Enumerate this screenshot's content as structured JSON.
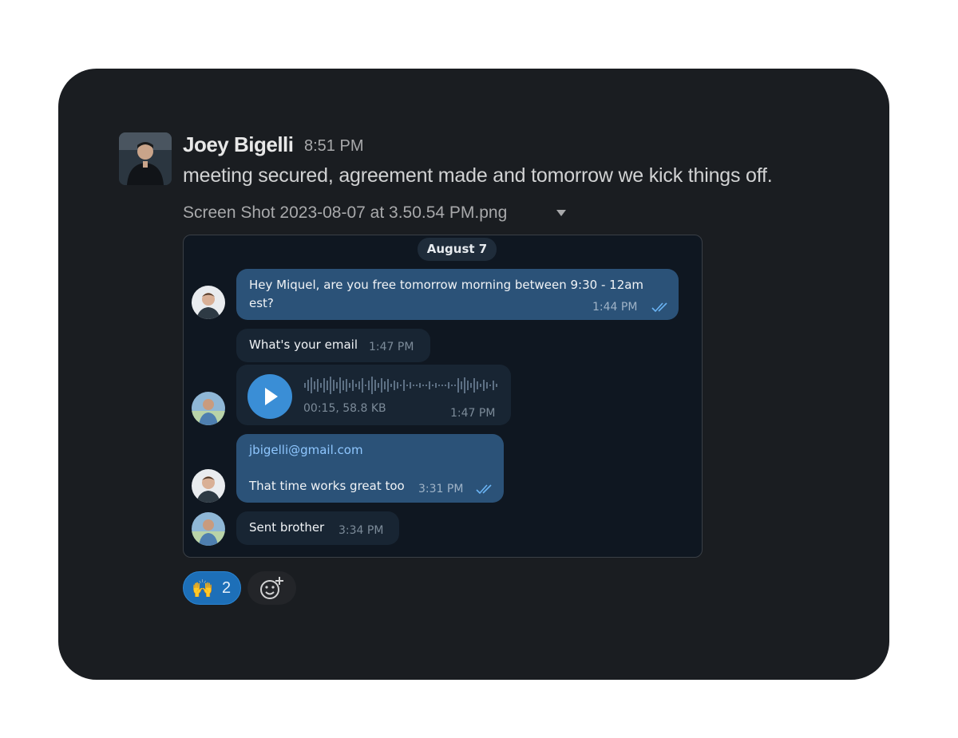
{
  "post": {
    "author": "Joey Bigelli",
    "time": "8:51 PM",
    "text": "meeting secured, agreement made and tomorrow we kick things off.",
    "attachment_name": "Screen Shot 2023-08-07 at 3.50.54 PM.png"
  },
  "screenshot": {
    "date": "August 7",
    "messages": [
      {
        "text_line1": "Hey Miquel, are you free tomorrow morning between 9:30 - 12am",
        "text_line2": "est?",
        "time": "1:44 PM"
      },
      {
        "text": "What's your email",
        "time": "1:47 PM"
      },
      {
        "voice_meta": "00:15, 58.8 KB",
        "time": "1:47 PM"
      },
      {
        "link": "jbigelli@gmail.com",
        "text": "That time works great too",
        "time": "3:31 PM"
      },
      {
        "text": "Sent brother",
        "time": "3:34 PM"
      }
    ]
  },
  "reactions": {
    "emoji": "🙌",
    "count": "2",
    "add_icon": "add-reaction-icon"
  },
  "colors": {
    "card": "#1a1d21",
    "outgoing_bubble": "#2b5278",
    "incoming_bubble": "#182533",
    "reaction": "#1d6fb8"
  }
}
